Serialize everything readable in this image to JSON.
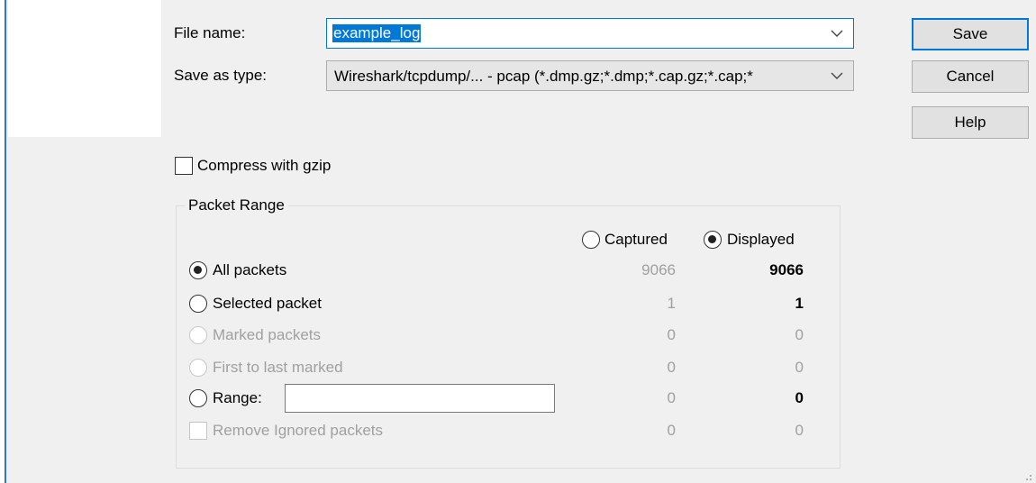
{
  "file_name": {
    "label": "File name:",
    "value": "example_log"
  },
  "save_as_type": {
    "label": "Save as type:",
    "value": "Wireshark/tcpdump/... - pcap (*.dmp.gz;*.dmp;*.cap.gz;*.cap;*"
  },
  "buttons": {
    "save": "Save",
    "cancel": "Cancel",
    "help": "Help"
  },
  "compress": {
    "label": "Compress with gzip",
    "checked": false
  },
  "packet_range": {
    "title": "Packet Range",
    "captured_label": "Captured",
    "displayed_label": "Displayed",
    "rows": [
      {
        "label": "All packets",
        "captured": "9066",
        "displayed": "9066"
      },
      {
        "label": "Selected packet",
        "captured": "1",
        "displayed": "1"
      },
      {
        "label": "Marked packets",
        "captured": "0",
        "displayed": "0"
      },
      {
        "label": "First to last marked",
        "captured": "0",
        "displayed": "0"
      },
      {
        "label": "Range:",
        "captured": "0",
        "displayed": "0",
        "input_value": ""
      },
      {
        "label": "Remove Ignored packets",
        "captured": "0",
        "displayed": "0"
      }
    ]
  },
  "colors": {
    "accent": "#0078d7",
    "disabled": "#a0a0a0"
  }
}
